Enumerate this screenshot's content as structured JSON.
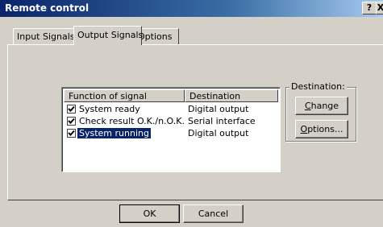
{
  "window": {
    "title": "Remote control",
    "help_label": "?",
    "close_label": "X"
  },
  "tabs": [
    {
      "label": "Input Signals",
      "active": false
    },
    {
      "label": "Output Signals",
      "active": true
    },
    {
      "label": "Options",
      "active": false
    }
  ],
  "signal_list": {
    "columns": [
      "Function of signal",
      "Destination"
    ],
    "rows": [
      {
        "function": "System ready",
        "destination": "Digital output",
        "checked": true,
        "selected": false
      },
      {
        "function": "Check result O.K./n.O.K.",
        "destination": "Serial interface",
        "checked": true,
        "selected": false
      },
      {
        "function": "System running",
        "destination": "Digital output",
        "checked": true,
        "selected": true
      }
    ]
  },
  "destination_group": {
    "label": "Destination:",
    "change_first": "C",
    "change_rest": "hange",
    "options_first": "O",
    "options_rest": "ptions..."
  },
  "footer": {
    "ok_label": "OK",
    "cancel_label": "Cancel"
  },
  "colors": {
    "selection": "#0a246a",
    "titlebar": "#0a246a",
    "face": "#d4d0c8"
  }
}
